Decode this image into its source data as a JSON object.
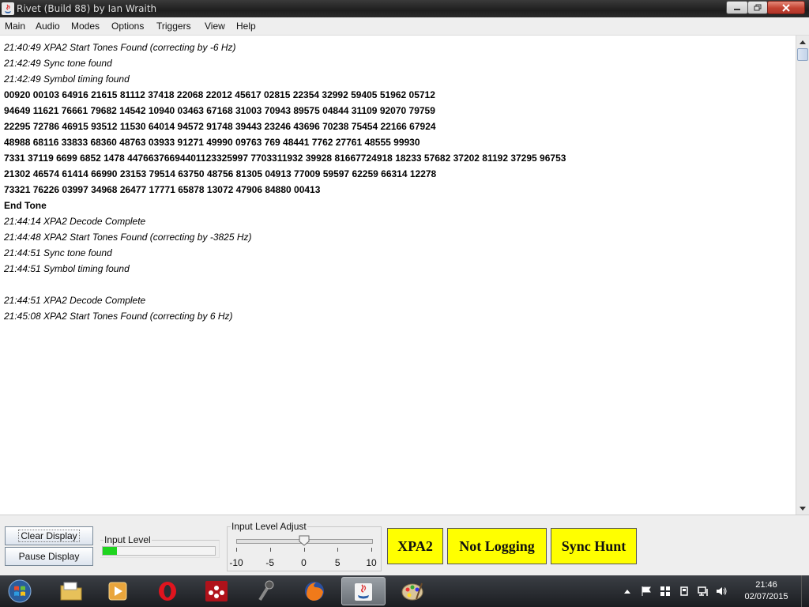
{
  "window": {
    "title": "Rivet (Build 88) by Ian Wraith"
  },
  "menu": [
    "Main",
    "Audio",
    "Modes",
    "Options",
    "Triggers",
    "View",
    "Help"
  ],
  "log": [
    {
      "text": "21:40:49 XPA2 Start Tones Found (correcting by -6 Hz)",
      "style": "status"
    },
    {
      "text": "21:42:49 Sync tone found",
      "style": "status"
    },
    {
      "text": "21:42:49 Symbol timing found",
      "style": "status"
    },
    {
      "text": "00920 00103 64916 21615 81112 37418 22068 22012 45617 02815 22354 32992 59405 51962 05712",
      "style": "data"
    },
    {
      "text": "94649 11621 76661 79682 14542 10940 03463 67168 31003 70943 89575 04844 31109 92070 79759",
      "style": "data"
    },
    {
      "text": "22295 72786 46915 93512 11530 64014 94572 91748 39443 23246 43696 70238 75454 22166 67924",
      "style": "data"
    },
    {
      "text": "48988 68116 33833 68360 48763 03933 91271 49990 09763 769 48441 7762 27761 48555 99930",
      "style": "data"
    },
    {
      "text": "7331 37119 6699 6852 1478 44766376694401123325997 7703311932 39928 81667724918 18233 57682 37202 81192 37295 96753",
      "style": "data"
    },
    {
      "text": "21302 46574 61414 66990 23153 79514 63750 48756 81305 04913 77009 59597 62259 66314 12278",
      "style": "data"
    },
    {
      "text": "73321 76226 03997 34968 26477 17771 65878 13072 47906 84880 00413",
      "style": "data"
    },
    {
      "text": "End Tone",
      "style": "data"
    },
    {
      "text": "21:44:14 XPA2 Decode Complete",
      "style": "status"
    },
    {
      "text": "21:44:48 XPA2 Start Tones Found (correcting by -3825 Hz)",
      "style": "status"
    },
    {
      "text": "21:44:51 Sync tone found",
      "style": "status"
    },
    {
      "text": "21:44:51 Symbol timing found",
      "style": "status"
    },
    {
      "text": "",
      "style": "status"
    },
    {
      "text": "21:44:51 XPA2 Decode Complete",
      "style": "status"
    },
    {
      "text": "21:45:08 XPA2 Start Tones Found (correcting by 6 Hz)",
      "style": "status"
    }
  ],
  "controls": {
    "clear_label": "Clear Display",
    "pause_label": "Pause Display",
    "input_level_label": "Input Level",
    "input_level_fraction": 0.13,
    "level_color": "#1ed41e",
    "adjust_label": "Input Level Adjust",
    "slider": {
      "min": -10,
      "max": 10,
      "value": 0,
      "tick_labels": [
        "-10",
        "-5",
        "0",
        "5",
        "10"
      ]
    }
  },
  "indicators": {
    "mode": "XPA2",
    "logging": "Not Logging",
    "sync": "Sync Hunt",
    "color": "#ffff00"
  },
  "taskbar": {
    "apps": [
      "start-orb",
      "file-explorer",
      "media-player",
      "opera",
      "mendeley",
      "microphone",
      "firefox",
      "java",
      "paint"
    ],
    "active_app": "java",
    "time": "21:46",
    "date": "02/07/2015"
  }
}
